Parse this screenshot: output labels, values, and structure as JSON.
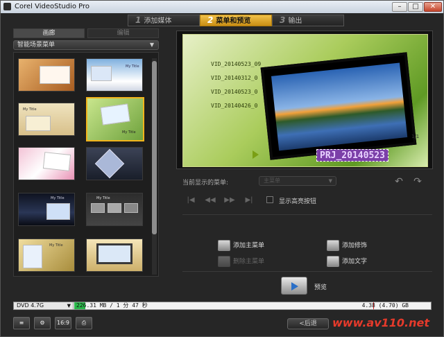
{
  "window": {
    "title": "Corel VideoStudio Pro",
    "min": "–",
    "max": "□",
    "close": "✕"
  },
  "steps": [
    {
      "num": "1",
      "label": "添加媒体"
    },
    {
      "num": "2",
      "label": "菜单和预览"
    },
    {
      "num": "3",
      "label": "输出"
    }
  ],
  "left_tabs": [
    "画廊",
    "编辑"
  ],
  "dropdown": {
    "value": "智能场景菜单",
    "arrow": "▼"
  },
  "thumbnail_text": {
    "my_title": "My Title"
  },
  "menu_preview": {
    "items": [
      "VID_20140523_09",
      "VID_20140312_0",
      "VID_20140523_0",
      "VID_20140426_0"
    ],
    "page": "1/1",
    "title": "PRJ_20140523"
  },
  "controls": {
    "current_menu_label": "当前显示的菜单:",
    "current_menu_value": "主菜单",
    "show_highlight_label": "显示高亮按钮"
  },
  "actions": {
    "add_main_menu": "添加主菜单",
    "delete_main_menu": "删除主菜单",
    "add_decoration": "添加修饰",
    "add_text": "添加文字",
    "preview": "预览"
  },
  "storage": {
    "disc": "DVD 4.7G",
    "used": "226.31 MB / 1 分 47 秒",
    "capacity": "4.38 (4.70) GB",
    "used_fraction": 0.047
  },
  "bottom": {
    "aspect_label": "16:9",
    "back_label": "<后退",
    "watermark": "www.av110.net"
  },
  "colors": {
    "accent": "#f2b41b",
    "title_purple": "#7b3fa8",
    "used_green": "#2bb84b",
    "watermark_red": "#e63a2b"
  }
}
